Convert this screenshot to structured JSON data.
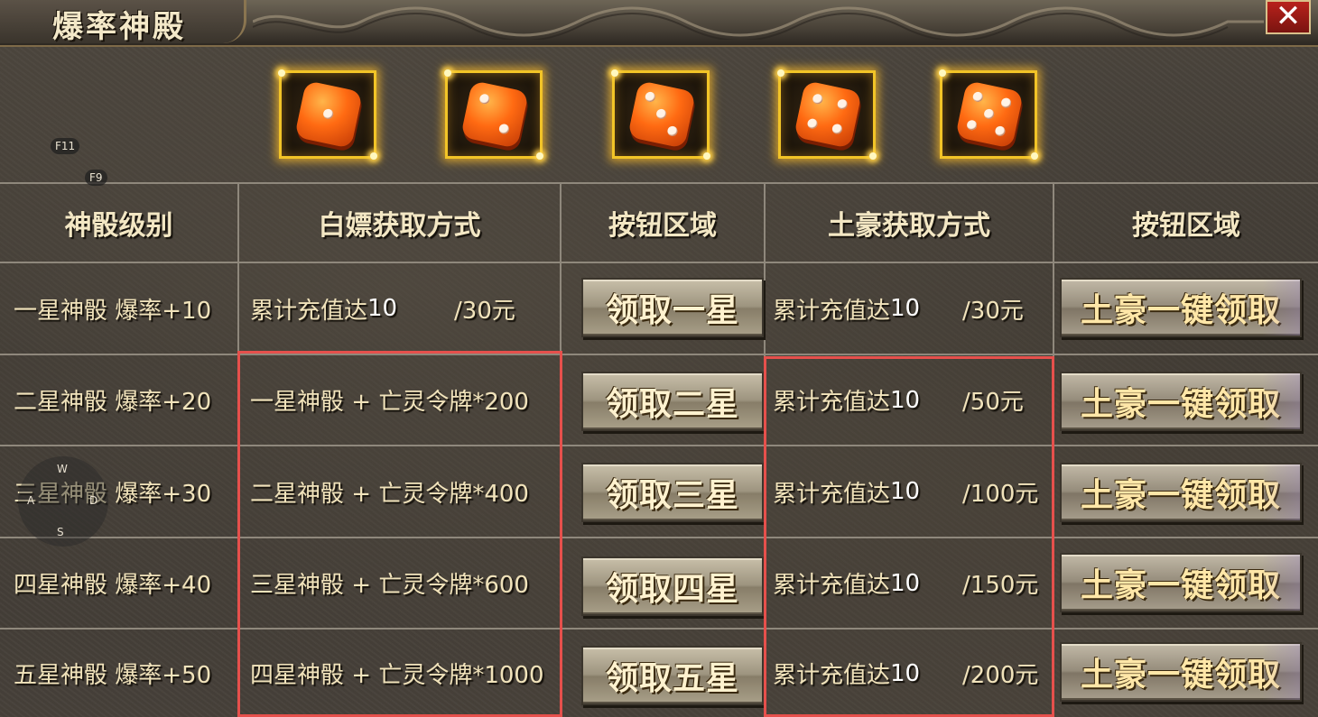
{
  "window": {
    "title": "爆率神殿",
    "close_label": "✕"
  },
  "hints": {
    "f11": "F11",
    "f9": "F9",
    "w": "W",
    "a": "A",
    "s": "S",
    "d": "D"
  },
  "dice": [
    {
      "name": "一星",
      "pips": 1
    },
    {
      "name": "二星",
      "pips": 2
    },
    {
      "name": "三星",
      "pips": 3
    },
    {
      "name": "四星",
      "pips": 4
    },
    {
      "name": "五星",
      "pips": 5
    }
  ],
  "headers": [
    "神骰级别",
    "白嫖获取方式",
    "按钮区域",
    "土豪获取方式",
    "按钮区域"
  ],
  "rows": [
    {
      "level": "一星神骰  爆率+10",
      "free_way": "累计充值达",
      "free_num": "10",
      "free_amt": "/30元",
      "btn": "领取一星",
      "rich_way": "累计充值达",
      "rich_num": "10",
      "rich_amt": "/30元",
      "rich_btn": "土豪一键领取"
    },
    {
      "level": "二星神骰  爆率+20",
      "free_way": "一星神骰 + 亡灵令牌*200",
      "btn": "领取二星",
      "rich_way": "累计充值达",
      "rich_num": "10",
      "rich_amt": "/50元",
      "rich_btn": "土豪一键领取"
    },
    {
      "level": "三星神骰  爆率+30",
      "free_way": "二星神骰 + 亡灵令牌*400",
      "btn": "领取三星",
      "rich_way": "累计充值达",
      "rich_num": "10",
      "rich_amt": "/100元",
      "rich_btn": "土豪一键领取"
    },
    {
      "level": "四星神骰  爆率+40",
      "free_way": "三星神骰 + 亡灵令牌*600",
      "btn": "领取四星",
      "rich_way": "累计充值达",
      "rich_num": "10",
      "rich_amt": "/150元",
      "rich_btn": "土豪一键领取"
    },
    {
      "level": "五星神骰  爆率+50",
      "free_way": "四星神骰 + 亡灵令牌*1000",
      "btn": "领取五星",
      "rich_way": "累计充值达",
      "rich_num": "10",
      "rich_amt": "/200元",
      "rich_btn": "土豪一键领取"
    }
  ],
  "colors": {
    "gold_border": "#f2c427",
    "highlight_box": "#e6504c",
    "close_red": "#b8221c"
  }
}
